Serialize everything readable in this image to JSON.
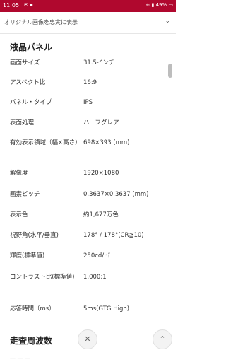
{
  "status": {
    "time": "11:05",
    "battery": "49%"
  },
  "banner": {
    "text": "オリジナル画像を忠実に表示"
  },
  "sections": [
    {
      "title": "液晶パネル"
    },
    {
      "title": "走査周波数"
    }
  ],
  "specs": [
    {
      "label": "画面サイズ",
      "value": "31.5インチ"
    },
    {
      "label": "アスペクト比",
      "value": "16:9"
    },
    {
      "label": "パネル・タイプ",
      "value": "IPS"
    },
    {
      "label": "表面処理",
      "value": "ハーフグレア"
    },
    {
      "label": "有効表示領域（幅×高さ）",
      "value": "698×393 (mm)"
    },
    {
      "label": "解像度",
      "value": "1920×1080"
    },
    {
      "label": "画素ピッチ",
      "value": "0.3637×0.3637 (mm)"
    },
    {
      "label": "表示色",
      "value": "約1,677万色"
    },
    {
      "label": "視野角(水平/垂直)",
      "value": "178° / 178°(CR≧10)"
    },
    {
      "label": "輝度(標準値)",
      "value": "250cd/㎡"
    },
    {
      "label": "コントラスト比(標準値)",
      "value": "1,000:1"
    },
    {
      "label": "応答時間（ms）",
      "value": "5ms(GTG High)"
    }
  ],
  "icons": {
    "collapse": "chevron-down-icon",
    "close": "close-icon",
    "up": "chevron-up-icon"
  }
}
